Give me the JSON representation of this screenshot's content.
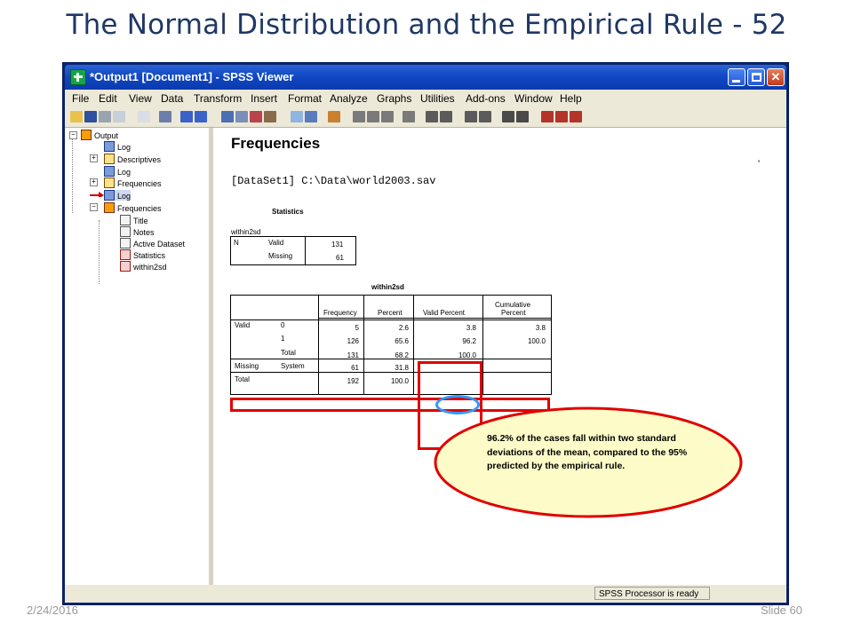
{
  "slide": {
    "title": "The Normal Distribution and the Empirical Rule - 52",
    "date": "2/24/2016",
    "slide_number": "Slide 60"
  },
  "window": {
    "title": "*Output1 [Document1] - SPSS Viewer",
    "menu": [
      "File",
      "Edit",
      "View",
      "Data",
      "Transform",
      "Insert",
      "Format",
      "Analyze",
      "Graphs",
      "Utilities",
      "Add-ons",
      "Window",
      "Help"
    ]
  },
  "outline": {
    "nodes": [
      "Output",
      "Log",
      "Descriptives",
      "Log",
      "Frequencies",
      "Log",
      "Frequencies",
      "Title",
      "Notes",
      "Active Dataset",
      "Statistics",
      "within2sd"
    ]
  },
  "viewer": {
    "heading": "Frequencies",
    "dataset_line": "[DataSet1] C:\\Data\\world2003.sav",
    "statistics": {
      "title": "Statistics",
      "variable": "within2sd",
      "row_n": "N",
      "valid_label": "Valid",
      "valid_value": "131",
      "missing_label": "Missing",
      "missing_value": "61"
    },
    "freq_table": {
      "title": "within2sd",
      "headers": [
        "Frequency",
        "Percent",
        "Valid Percent",
        "Cumulative Percent"
      ],
      "cumulative_line1": "Cumulative",
      "cumulative_line2": "Percent",
      "rows": [
        {
          "group": "Valid",
          "label": "0",
          "frequency": "5",
          "percent": "2.6",
          "valid_percent": "3.8",
          "cumulative": "3.8"
        },
        {
          "group": "",
          "label": "1",
          "frequency": "126",
          "percent": "65.6",
          "valid_percent": "96.2",
          "cumulative": "100.0"
        },
        {
          "group": "",
          "label": "Total",
          "frequency": "131",
          "percent": "68.2",
          "valid_percent": "100.0",
          "cumulative": ""
        },
        {
          "group": "Missing",
          "label": "System",
          "frequency": "61",
          "percent": "31.8",
          "valid_percent": "",
          "cumulative": ""
        },
        {
          "group": "Total",
          "label": "",
          "frequency": "192",
          "percent": "100.0",
          "valid_percent": "",
          "cumulative": ""
        }
      ]
    }
  },
  "annotation": {
    "text": "96.2% of the cases  fall within two standard deviations of the mean, compared to the 95% predicted by the empirical rule."
  },
  "status": {
    "text": "SPSS  Processor is ready"
  },
  "colors": {
    "title": "#1f3864",
    "highlight": "#e00000",
    "circle": "#3399ff",
    "callout_fill": "#fdfcc8"
  }
}
